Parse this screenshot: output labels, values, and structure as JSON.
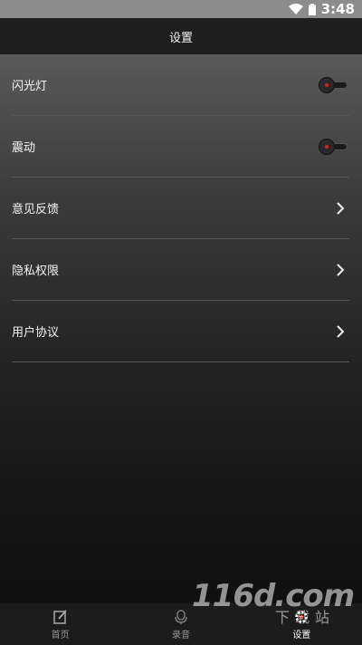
{
  "status_bar": {
    "time": "3:48"
  },
  "header": {
    "title": "设置"
  },
  "settings": {
    "flash_label": "闪光灯",
    "vibrate_label": "震动",
    "feedback_label": "意见反馈",
    "privacy_label": "隐私权限",
    "agreement_label": "用户协议",
    "flash_on": false,
    "vibrate_on": false
  },
  "bottom_nav": {
    "home_label": "首页",
    "record_label": "录音",
    "settings_label": "设置",
    "active": "settings"
  },
  "watermark": {
    "main": "116d.com",
    "sub": "下载站"
  },
  "colors": {
    "accent_dot": "#dd2222",
    "divider": "#585858"
  }
}
